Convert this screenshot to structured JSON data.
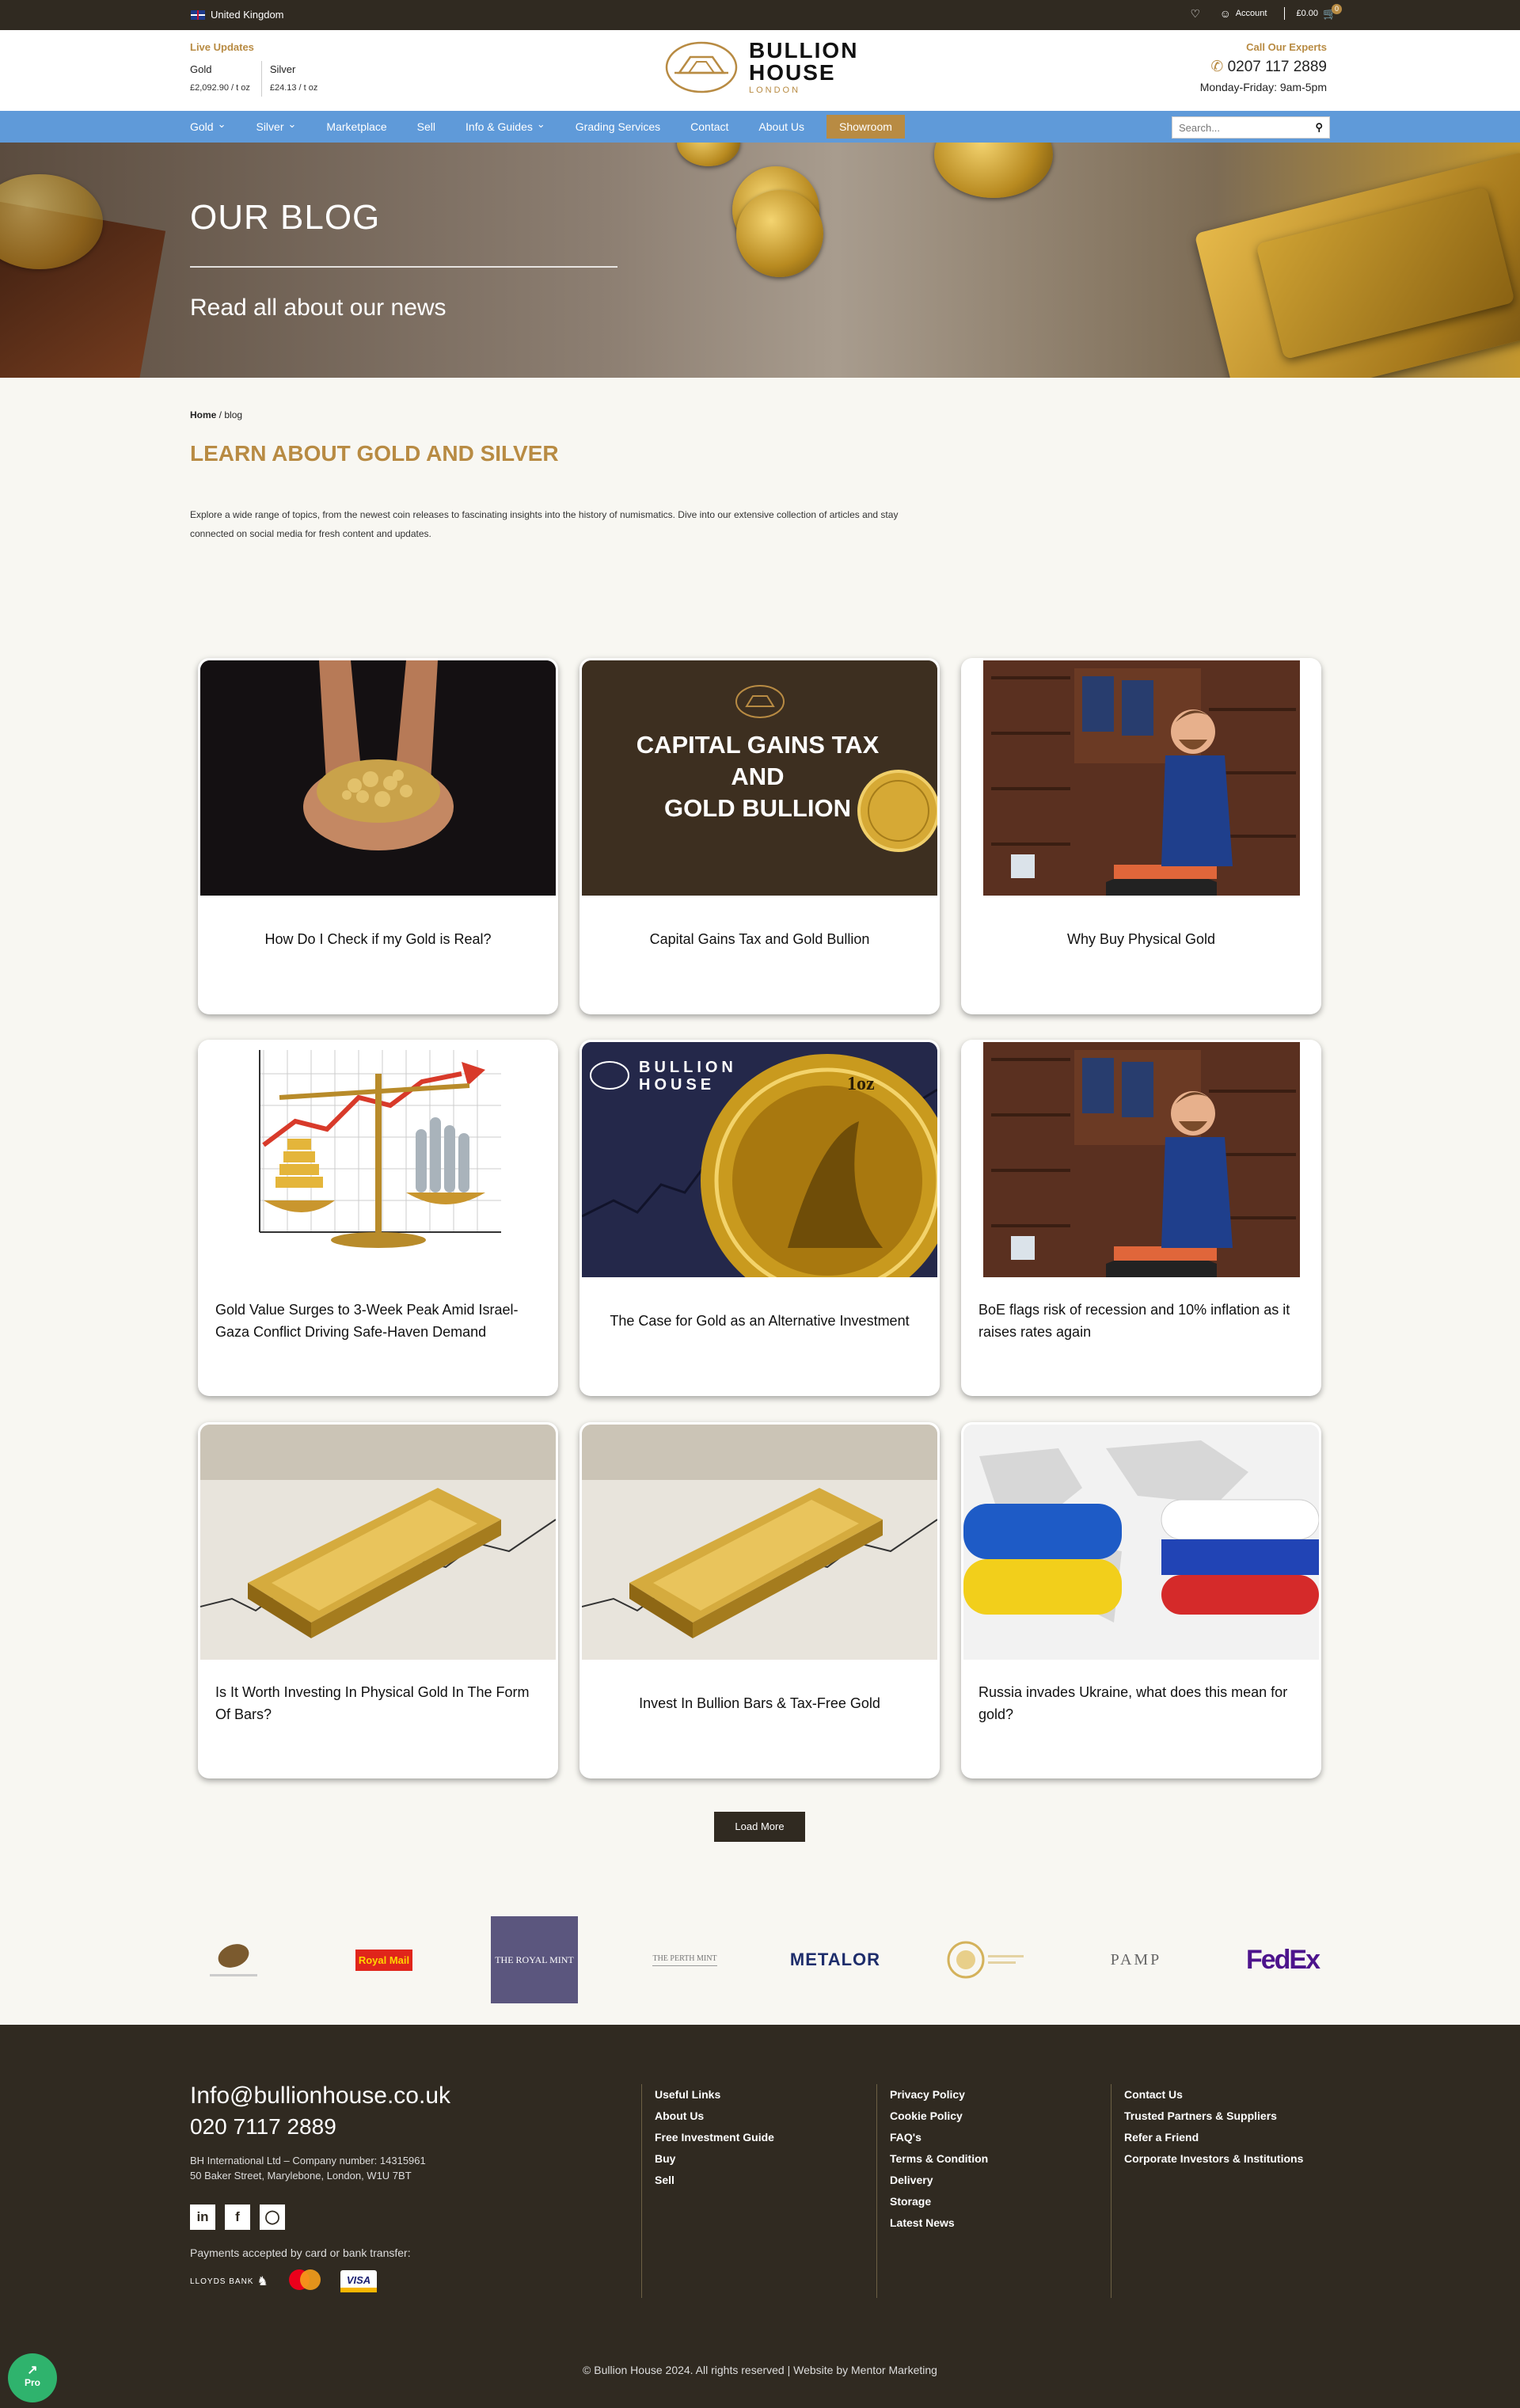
{
  "topbar": {
    "region": "United Kingdom",
    "account": "Account",
    "cart_total": "£0.00",
    "cart_count": "0"
  },
  "header": {
    "live_title": "Live Updates",
    "gold_label": "Gold",
    "gold_price": "£2,092.90 / t oz",
    "silver_label": "Silver",
    "silver_price": "£24.13 / t oz",
    "logo_line1": "BULLION",
    "logo_line2": "HOUSE",
    "logo_line3": "LONDON",
    "call_label": "Call Our Experts",
    "phone": "0207 117 2889",
    "hours": "Monday-Friday: 9am-5pm"
  },
  "nav": {
    "items": [
      {
        "label": "Gold",
        "caret": true
      },
      {
        "label": "Silver",
        "caret": true
      },
      {
        "label": "Marketplace",
        "caret": false
      },
      {
        "label": "Sell",
        "caret": false
      },
      {
        "label": "Info & Guides",
        "caret": true
      },
      {
        "label": "Grading Services",
        "caret": false
      },
      {
        "label": "Contact",
        "caret": false
      },
      {
        "label": "About Us",
        "caret": false
      }
    ],
    "showroom": "Showroom",
    "search_placeholder": "Search..."
  },
  "hero": {
    "title": "OUR BLOG",
    "subtitle": "Read all about our news"
  },
  "breadcrumb": {
    "home": "Home",
    "current": "blog"
  },
  "section": {
    "title": "LEARN ABOUT GOLD AND SILVER",
    "intro": "Explore a wide range of topics, from the newest coin releases to fascinating insights into the history of numismatics. Dive into our extensive collection of articles and stay connected on social media for fresh content and updates."
  },
  "posts": [
    {
      "title": "How Do I Check if my Gold is Real?",
      "align": "center"
    },
    {
      "title": "Capital Gains Tax and Gold Bullion",
      "align": "center",
      "image_text": [
        "CAPITAL GAINS TAX",
        "AND",
        "GOLD BULLION"
      ]
    },
    {
      "title": "Why Buy Physical Gold",
      "align": "center"
    },
    {
      "title": "Gold Value Surges to 3-Week Peak Amid Israel-Gaza Conflict Driving Safe-Haven Demand",
      "align": "left"
    },
    {
      "title": "The Case for Gold as an Alternative Investment",
      "align": "center",
      "image_text": [
        "BULLION",
        "HOUSE",
        "1oz"
      ]
    },
    {
      "title": "BoE flags risk of recession and 10% inflation as it raises rates again",
      "align": "left"
    },
    {
      "title": "Is It Worth Investing In Physical Gold In The Form Of Bars?",
      "align": "left"
    },
    {
      "title": "Invest In Bullion Bars & Tax-Free Gold",
      "align": "center"
    },
    {
      "title": "Russia invades Ukraine, what does this mean for gold?",
      "align": "left"
    }
  ],
  "load_more": "Load More",
  "partners": [
    "THE ROYAL MINT",
    "Royal Mail",
    "THE PERTH MINT",
    "METALOR",
    "PAMP",
    "FedEx"
  ],
  "footer": {
    "email": "Info@bullionhouse.co.uk",
    "phone": "020 7117 2889",
    "company": "BH International Ltd – Company number: 14315961",
    "address": "50 Baker Street, Marylebone, London, W1U 7BT",
    "payments": "Payments accepted by card or bank transfer:",
    "lloyds": "LLOYDS BANK",
    "col1": [
      "Useful Links",
      "About Us",
      "Free Investment Guide",
      "Buy",
      "Sell"
    ],
    "col2": [
      "Privacy Policy",
      "Cookie Policy",
      "FAQ's",
      "Terms & Condition",
      "Delivery",
      "Storage",
      "Latest News"
    ],
    "col3": [
      "Contact Us",
      "Trusted Partners & Suppliers",
      "Refer a Friend",
      "Corporate Investors & Institutions"
    ],
    "copyright": "© Bullion House 2024. All rights reserved | Website by Mentor Marketing"
  },
  "pro_badge": "Pro"
}
